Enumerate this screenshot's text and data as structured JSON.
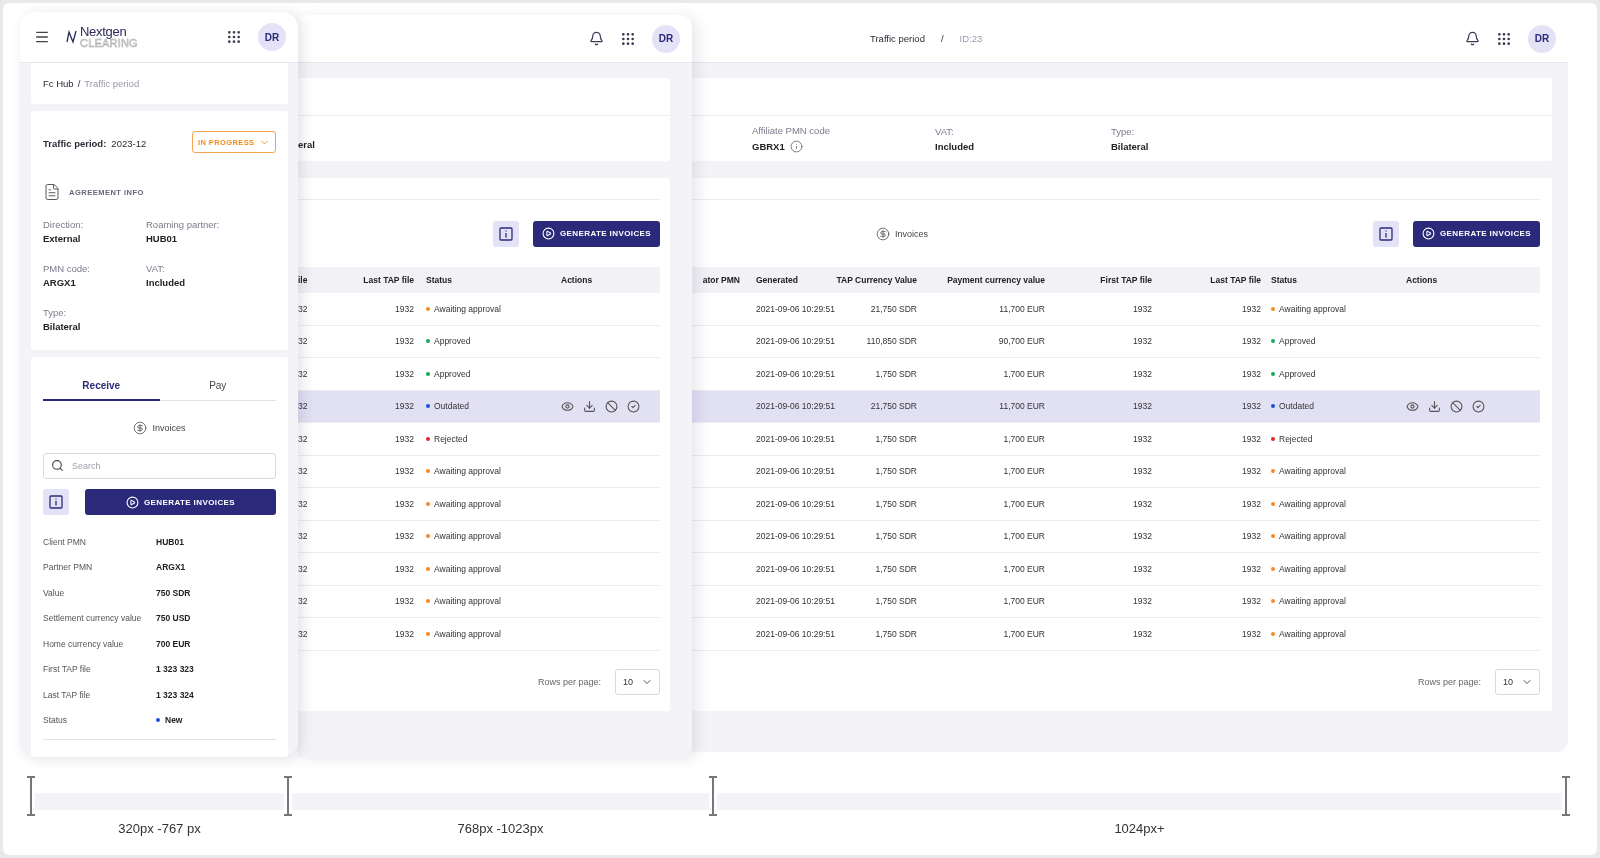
{
  "mobile": {
    "logo": {
      "name": "Nextgen",
      "tagline": "CLEARING"
    },
    "avatar": "DR",
    "breadcrumb": [
      {
        "label": "Fc Hub",
        "current": false,
        "separator": "/"
      },
      {
        "label": "Traffic period",
        "current": true
      }
    ],
    "period": {
      "label": "Traffic period:",
      "value": "2023-12",
      "status": "IN PROGRESS"
    },
    "agreement": {
      "title": "AGREEMENT INFO",
      "fields": [
        {
          "label": "Direction:",
          "value": "External"
        },
        {
          "label": "Roaming partner:",
          "value": "HUB01"
        },
        {
          "label": "PMN code:",
          "value": "ARGX1"
        },
        {
          "label": "VAT:",
          "value": "Included"
        },
        {
          "label": "Type:",
          "value": "Bilateral"
        }
      ]
    },
    "tabs": [
      {
        "label": "Receive",
        "selected": true
      },
      {
        "label": "Pay",
        "selected": false
      }
    ],
    "invoices_label": "Invoices",
    "search": {
      "placeholder": "Search"
    },
    "generate_button": "GENERATE INVOICES",
    "details": [
      {
        "label": "Client PMN",
        "value": "HUB01"
      },
      {
        "label": "Partner PMN",
        "value": "ARGX1"
      },
      {
        "label": "Value",
        "value": "750 SDR"
      },
      {
        "label": "Settlement currency value",
        "value": "750 USD"
      },
      {
        "label": "Home currency value",
        "value": "700 EUR"
      },
      {
        "label": "First TAP file",
        "value": "1 323 323"
      },
      {
        "label": "Last TAP file",
        "value": "1 323 324"
      },
      {
        "label": "Status",
        "value": "New",
        "color": "#1a4fd6"
      }
    ]
  },
  "tablet": {
    "avatar": "DR",
    "field_value": "eral",
    "generate_button": "GENERATE INVOICES",
    "columns": [
      "ile",
      "Last TAP file",
      "Status",
      "Actions"
    ],
    "rows": [
      {
        "file": "32",
        "last_tap": "1932",
        "status": "Awaiting approval",
        "color": "#f7891f",
        "selected": false
      },
      {
        "file": "32",
        "last_tap": "1932",
        "status": "Approved",
        "color": "#16a85a",
        "selected": false
      },
      {
        "file": "32",
        "last_tap": "1932",
        "status": "Approved",
        "color": "#16a85a",
        "selected": false
      },
      {
        "file": "32",
        "last_tap": "1932",
        "status": "Outdated",
        "color": "#1a4fd6",
        "selected": true
      },
      {
        "file": "32",
        "last_tap": "1932",
        "status": "Rejected",
        "color": "#e32626",
        "selected": false
      },
      {
        "file": "32",
        "last_tap": "1932",
        "status": "Awaiting approval",
        "color": "#f7891f",
        "selected": false
      },
      {
        "file": "32",
        "last_tap": "1932",
        "status": "Awaiting approval",
        "color": "#f7891f",
        "selected": false
      },
      {
        "file": "32",
        "last_tap": "1932",
        "status": "Awaiting approval",
        "color": "#f7891f",
        "selected": false
      },
      {
        "file": "32",
        "last_tap": "1932",
        "status": "Awaiting approval",
        "color": "#f7891f",
        "selected": false
      },
      {
        "file": "32",
        "last_tap": "1932",
        "status": "Awaiting approval",
        "color": "#f7891f",
        "selected": false
      },
      {
        "file": "32",
        "last_tap": "1932",
        "status": "Awaiting approval",
        "color": "#f7891f",
        "selected": false
      }
    ],
    "rows_per_page": {
      "label": "Rows per page:",
      "value": "10"
    }
  },
  "desktop": {
    "breadcrumb": [
      {
        "label": "Traffic period",
        "current": false,
        "separator": "/"
      },
      {
        "label": "ID:23",
        "current": true
      }
    ],
    "avatar": "DR",
    "fields": [
      {
        "label": "Affiliate PMN code",
        "value": "GBRX1",
        "info": true
      },
      {
        "label": "VAT:",
        "value": "Included",
        "info": false
      },
      {
        "label": "Type:",
        "value": "Bilateral",
        "info": false
      }
    ],
    "invoices_label": "Invoices",
    "generate_button": "GENERATE INVOICES",
    "columns": [
      "ator PMN",
      "Generated",
      "TAP Currency Value",
      "Payment currency value",
      "First TAP file",
      "Last TAP file",
      "Status",
      "Actions"
    ],
    "rows": [
      {
        "generated": "2021-09-06 10:29:51",
        "tap_value": "21,750 SDR",
        "payment_value": "11,700 EUR",
        "first_tap": "1932",
        "last_tap": "1932",
        "status": "Awaiting approval",
        "color": "#f7891f",
        "selected": false
      },
      {
        "generated": "2021-09-06 10:29:51",
        "tap_value": "110,850 SDR",
        "payment_value": "90,700 EUR",
        "first_tap": "1932",
        "last_tap": "1932",
        "status": "Approved",
        "color": "#16a85a",
        "selected": false
      },
      {
        "generated": "2021-09-06 10:29:51",
        "tap_value": "1,750 SDR",
        "payment_value": "1,700 EUR",
        "first_tap": "1932",
        "last_tap": "1932",
        "status": "Approved",
        "color": "#16a85a",
        "selected": false
      },
      {
        "generated": "2021-09-06 10:29:51",
        "tap_value": "21,750 SDR",
        "payment_value": "11,700 EUR",
        "first_tap": "1932",
        "last_tap": "1932",
        "status": "Outdated",
        "color": "#1a4fd6",
        "selected": true
      },
      {
        "generated": "2021-09-06 10:29:51",
        "tap_value": "1,750 SDR",
        "payment_value": "1,700 EUR",
        "first_tap": "1932",
        "last_tap": "1932",
        "status": "Rejected",
        "color": "#e32626",
        "selected": false
      },
      {
        "generated": "2021-09-06 10:29:51",
        "tap_value": "1,750 SDR",
        "payment_value": "1,700 EUR",
        "first_tap": "1932",
        "last_tap": "1932",
        "status": "Awaiting approval",
        "color": "#f7891f",
        "selected": false
      },
      {
        "generated": "2021-09-06 10:29:51",
        "tap_value": "1,750 SDR",
        "payment_value": "1,700 EUR",
        "first_tap": "1932",
        "last_tap": "1932",
        "status": "Awaiting approval",
        "color": "#f7891f",
        "selected": false
      },
      {
        "generated": "2021-09-06 10:29:51",
        "tap_value": "1,750 SDR",
        "payment_value": "1,700 EUR",
        "first_tap": "1932",
        "last_tap": "1932",
        "status": "Awaiting approval",
        "color": "#f7891f",
        "selected": false
      },
      {
        "generated": "2021-09-06 10:29:51",
        "tap_value": "1,750 SDR",
        "payment_value": "1,700 EUR",
        "first_tap": "1932",
        "last_tap": "1932",
        "status": "Awaiting approval",
        "color": "#f7891f",
        "selected": false
      },
      {
        "generated": "2021-09-06 10:29:51",
        "tap_value": "1,750 SDR",
        "payment_value": "1,700 EUR",
        "first_tap": "1932",
        "last_tap": "1932",
        "status": "Awaiting approval",
        "color": "#f7891f",
        "selected": false
      },
      {
        "generated": "2021-09-06 10:29:51",
        "tap_value": "1,750 SDR",
        "payment_value": "1,700 EUR",
        "first_tap": "1932",
        "last_tap": "1932",
        "status": "Awaiting approval",
        "color": "#f7891f",
        "selected": false
      }
    ],
    "rows_per_page": {
      "label": "Rows per page:",
      "value": "10"
    }
  },
  "breakpoints": [
    {
      "label": "320px -767 px"
    },
    {
      "label": "768px -1023px"
    },
    {
      "label": "1024px+"
    }
  ]
}
